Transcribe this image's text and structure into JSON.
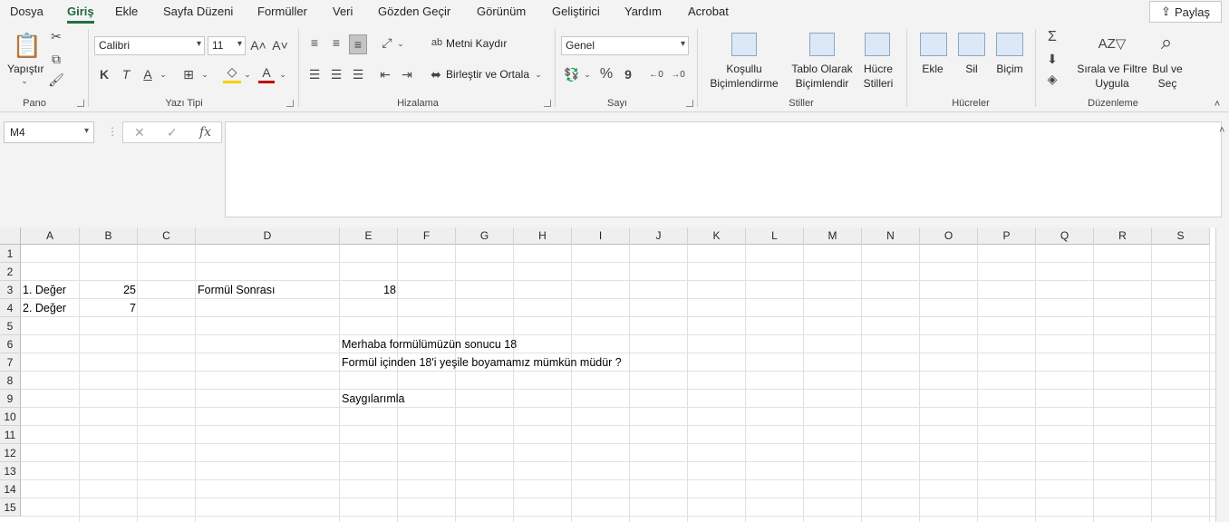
{
  "menu": {
    "tabs": [
      "Dosya",
      "Giriş",
      "Ekle",
      "Sayfa Düzeni",
      "Formüller",
      "Veri",
      "Gözden Geçir",
      "Görünüm",
      "Geliştirici",
      "Yardım",
      "Acrobat"
    ],
    "active_tab": "Giriş",
    "share_label": "Paylaş"
  },
  "ribbon": {
    "pano": {
      "label": "Pano",
      "paste": "Yapıştır"
    },
    "font": {
      "label": "Yazı Tipi",
      "name": "Calibri",
      "size": "11",
      "bold": "K",
      "italic": "T",
      "underline": "A",
      "fontcolor": "A"
    },
    "align": {
      "label": "Hizalama",
      "wrap": "Metni Kaydır",
      "merge": "Birleştir ve Ortala"
    },
    "number": {
      "label": "Sayı",
      "format": "Genel",
      "percent": "%",
      "comma": "9"
    },
    "styles": {
      "label": "Stiller",
      "conditional_1": "Koşullu",
      "conditional_2": "Biçimlendirme",
      "table_1": "Tablo Olarak",
      "table_2": "Biçimlendir",
      "cell_1": "Hücre",
      "cell_2": "Stilleri"
    },
    "cells": {
      "label": "Hücreler",
      "insert": "Ekle",
      "delete": "Sil",
      "format": "Biçim"
    },
    "editing": {
      "label": "Düzenleme",
      "sort_1": "Sırala ve Filtre",
      "sort_2": "Uygula",
      "find_1": "Bul ve",
      "find_2": "Seç"
    }
  },
  "formula_bar": {
    "name_box": "M4",
    "fx": "fx",
    "formula": ""
  },
  "sheet": {
    "columns": [
      "A",
      "B",
      "C",
      "D",
      "E",
      "F",
      "G",
      "H",
      "I",
      "J",
      "K",
      "L",
      "M",
      "N",
      "O",
      "P",
      "Q",
      "R",
      "S"
    ],
    "rows": [
      "1",
      "2",
      "3",
      "4",
      "5",
      "6",
      "7",
      "8",
      "9",
      "10",
      "11",
      "12",
      "13",
      "14",
      "15"
    ],
    "cells": {
      "A3": "1. Değer",
      "B3": "25",
      "D3": "Formül Sonrası",
      "E3": "18",
      "A4": "2. Değer",
      "B4": "7",
      "E6": "Merhaba formülümüzün sonucu 18",
      "E7": "Formül içinden 18'i yeşile boyamamız mümkün müdür ?",
      "E9": "Saygılarımla"
    }
  },
  "colors": {
    "accent": "#1e7145",
    "grid": "#e1e1e1",
    "header_bg": "#efefef"
  }
}
